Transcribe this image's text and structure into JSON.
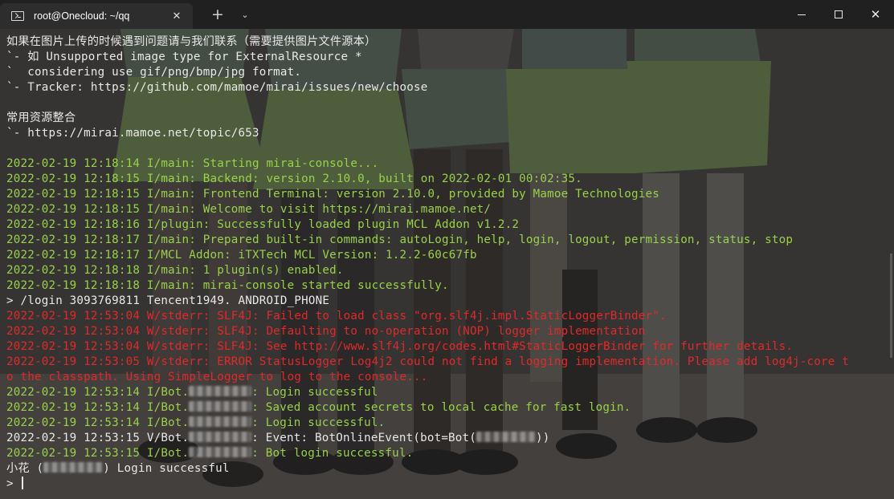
{
  "window": {
    "tab_title": "root@Onecloud: ~/qq",
    "tab_close_glyph": "✕",
    "new_tab_glyph": "+",
    "dropdown_glyph": "⌄",
    "close_glyph": "✕"
  },
  "terminal": {
    "lines": [
      {
        "color": "#e8e8e8",
        "text": "如果在图片上传的时候遇到问题请与我们联系（需要提供图片文件源本）"
      },
      {
        "color": "#e8e8e8",
        "text": "`- 如 Unsupported image type for ExternalResource *"
      },
      {
        "color": "#e8e8e8",
        "text": "`  considering use gif/png/bmp/jpg format."
      },
      {
        "color": "#e8e8e8",
        "text": "`- Tracker: https://github.com/mamoe/mirai/issues/new/choose"
      },
      {
        "color": "#e8e8e8",
        "text": ""
      },
      {
        "color": "#e8e8e8",
        "text": "常用资源整合"
      },
      {
        "color": "#e8e8e8",
        "text": "`- https://mirai.mamoe.net/topic/653"
      },
      {
        "color": "#e8e8e8",
        "text": ""
      },
      {
        "color": "#9ad14a",
        "text": "2022-02-19 12:18:14 I/main: Starting mirai-console..."
      },
      {
        "color": "#9ad14a",
        "text": "2022-02-19 12:18:15 I/main: Backend: version 2.10.0, built on 2022-02-01 00:02:35."
      },
      {
        "color": "#9ad14a",
        "text": "2022-02-19 12:18:15 I/main: Frontend Terminal: version 2.10.0, provided by Mamoe Technologies"
      },
      {
        "color": "#9ad14a",
        "text": "2022-02-19 12:18:15 I/main: Welcome to visit https://mirai.mamoe.net/"
      },
      {
        "color": "#9ad14a",
        "text": "2022-02-19 12:18:16 I/plugin: Successfully loaded plugin MCL Addon v1.2.2"
      },
      {
        "color": "#9ad14a",
        "text": "2022-02-19 12:18:17 I/main: Prepared built-in commands: autoLogin, help, login, logout, permission, status, stop"
      },
      {
        "color": "#9ad14a",
        "text": "2022-02-19 12:18:17 I/MCL Addon: iTXTech MCL Version: 1.2.2-60c67fb"
      },
      {
        "color": "#9ad14a",
        "text": "2022-02-19 12:18:18 I/main: 1 plugin(s) enabled."
      },
      {
        "color": "#9ad14a",
        "text": "2022-02-19 12:18:18 I/main: mirai-console started successfully."
      },
      {
        "color": "#e8e8e8",
        "text": "> /login 3093769811 Tencent1949. ANDROID_PHONE"
      },
      {
        "color": "#e02a2a",
        "text": "2022-02-19 12:53:04 W/stderr: SLF4J: Failed to load class \"org.slf4j.impl.StaticLoggerBinder\"."
      },
      {
        "color": "#e02a2a",
        "text": "2022-02-19 12:53:04 W/stderr: SLF4J: Defaulting to no-operation (NOP) logger implementation"
      },
      {
        "color": "#e02a2a",
        "text": "2022-02-19 12:53:04 W/stderr: SLF4J: See http://www.slf4j.org/codes.html#StaticLoggerBinder for further details."
      },
      {
        "color": "#e02a2a",
        "text": "2022-02-19 12:53:05 W/stderr: ERROR StatusLogger Log4j2 could not find a logging implementation. Please add log4j-core t"
      },
      {
        "color": "#e02a2a",
        "text": "o the classpath. Using SimpleLogger to log to the console..."
      }
    ],
    "bot_lines": [
      {
        "color": "#9ad14a",
        "prefix": "2022-02-19 12:53:14 I/Bot.",
        "suffix": ": Login successful"
      },
      {
        "color": "#9ad14a",
        "prefix": "2022-02-19 12:53:14 I/Bot.",
        "suffix": ": Saved account secrets to local cache for fast login."
      },
      {
        "color": "#9ad14a",
        "prefix": "2022-02-19 12:53:14 I/Bot.",
        "suffix": ": Login successful."
      },
      {
        "color": "#e8e8e8",
        "prefix": "2022-02-19 12:53:15 V/Bot.",
        "suffix": ": Event: BotOnlineEvent(bot=Bot(",
        "suffix2": "))"
      },
      {
        "color": "#9ad14a",
        "prefix": "2022-02-19 12:53:15 I/Bot.",
        "suffix": ": Bot login successful."
      }
    ],
    "final_line": {
      "color": "#e8e8e8",
      "prefix": "小花 (",
      "suffix": ") Login successful"
    },
    "prompt": "> "
  }
}
